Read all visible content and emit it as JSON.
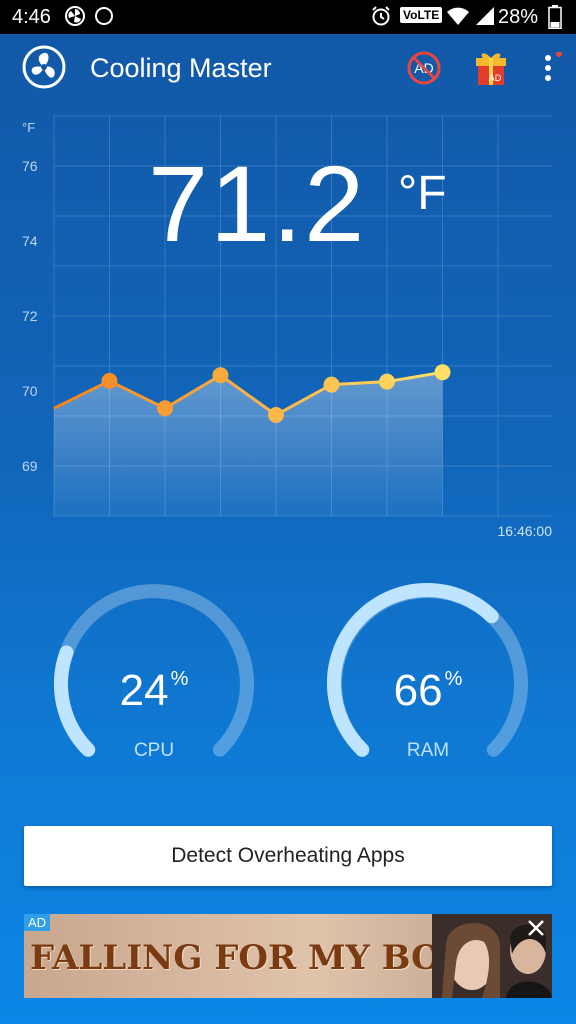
{
  "status_bar": {
    "time": "4:46",
    "carrier_badge": "VoLTE",
    "battery": "28%"
  },
  "app_bar": {
    "title": "Cooling Master",
    "no_ad_label": "AD",
    "gift_label": "AD"
  },
  "temperature": {
    "value": "71.2",
    "unit": "°F"
  },
  "chart_data": {
    "type": "line",
    "y_unit_label": "°F",
    "y_ticks": [
      "76",
      "74",
      "72",
      "70",
      "69"
    ],
    "x_label": "16:46:00",
    "values": [
      69.77,
      70.27,
      69.77,
      70.42,
      69.68,
      70.17,
      70.25,
      70.5
    ],
    "colors": {
      "start": "#f5821f",
      "end": "#ffe066"
    }
  },
  "gauges": [
    {
      "value": "24",
      "unit": "%",
      "label": "CPU",
      "percent": 24
    },
    {
      "value": "66",
      "unit": "%",
      "label": "RAM",
      "percent": 66
    }
  ],
  "detect_button": {
    "label": "Detect Overheating Apps"
  },
  "ad": {
    "badge": "AD",
    "text": "FALLING FOR MY BOSS"
  }
}
